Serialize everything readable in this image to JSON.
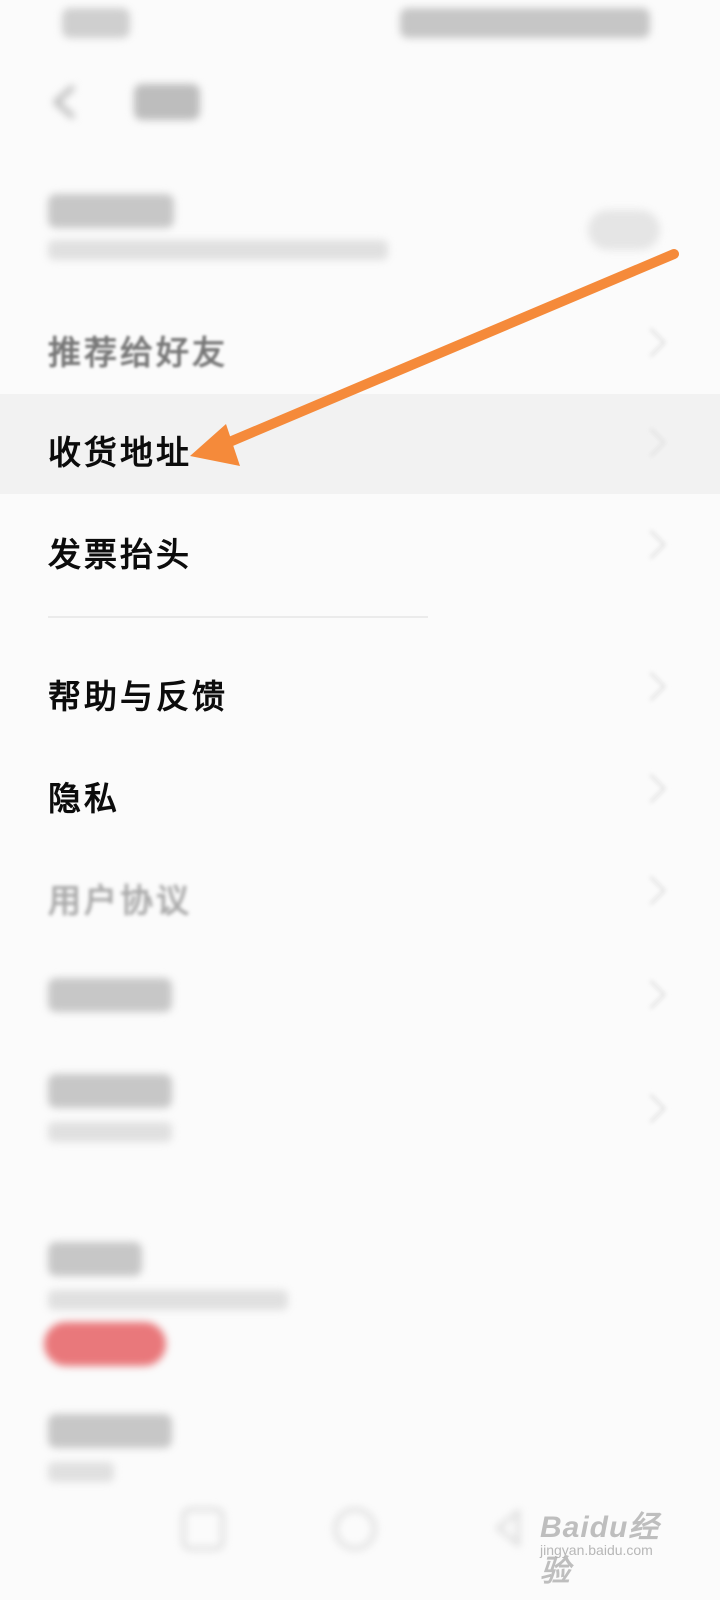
{
  "rows": [
    {
      "id": "recommend",
      "label": "推荐给好友"
    },
    {
      "id": "address",
      "label": "收货地址"
    },
    {
      "id": "invoice",
      "label": "发票抬头"
    },
    {
      "id": "help",
      "label": "帮助与反馈"
    },
    {
      "id": "privacy",
      "label": "隐私"
    },
    {
      "id": "agreement",
      "label": "用户协议"
    }
  ],
  "highlighted_row": "address",
  "annotation": {
    "arrow_color": "#f58a3a",
    "points_to": "address"
  },
  "watermark": {
    "brand": "Baidu经验",
    "url": "jingyan.baidu.com"
  },
  "colors": {
    "background": "#fbfbfb",
    "highlight": "#f2f2f2",
    "red_pill": "#e9787b"
  }
}
